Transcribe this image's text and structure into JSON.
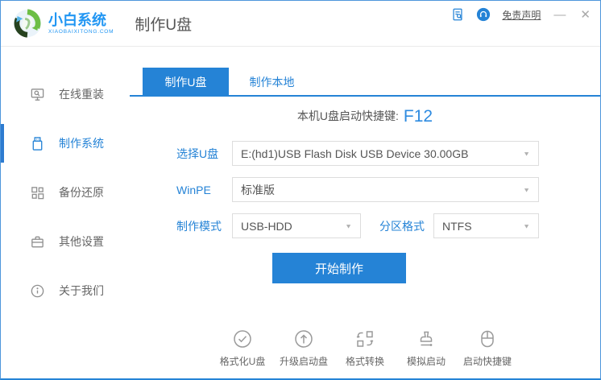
{
  "colors": {
    "primary": "#2583D6",
    "logo_blue": "#2196F3",
    "active_tab_bg": "#2583D6",
    "window_border": "#4E96DB",
    "text_gray": "#555555",
    "sidebar_text": "#666666"
  },
  "icons": {
    "dropdown_arrow": "▼",
    "titlebar": [
      "feedback-doc-icon",
      "support-headset-icon"
    ],
    "logo": "sync-circle-logo"
  },
  "titlebar": {
    "disclaimer_label": "免责声明",
    "minimize_glyph": "—",
    "close_glyph": "✕"
  },
  "header": {
    "logo_title": "小白系统",
    "logo_subtitle": "XIAOBAIXITONG.COM",
    "page_title": "制作U盘"
  },
  "sidebar": {
    "items": [
      {
        "label": "在线重装",
        "icon": "monitor-reinstall-icon",
        "active": false
      },
      {
        "label": "制作系统",
        "icon": "usb-drive-icon",
        "active": true
      },
      {
        "label": "备份还原",
        "icon": "backup-grid-icon",
        "active": false
      },
      {
        "label": "其他设置",
        "icon": "toolbox-icon",
        "active": false
      },
      {
        "label": "关于我们",
        "icon": "info-circle-icon",
        "active": false
      }
    ]
  },
  "tabs": [
    {
      "label": "制作U盘",
      "active": true
    },
    {
      "label": "制作本地",
      "active": false
    }
  ],
  "main": {
    "hotkey_label": "本机U盘启动快捷键:",
    "hotkey_value": "F12",
    "form": {
      "usb_drive": {
        "label": "选择U盘",
        "value": "E:(hd1)USB Flash Disk USB Device 30.00GB"
      },
      "winpe": {
        "label": "WinPE",
        "value": "标准版"
      },
      "make_mode": {
        "label": "制作模式",
        "value": "USB-HDD"
      },
      "partition": {
        "label": "分区格式",
        "value": "NTFS"
      }
    },
    "start_button_label": "开始制作",
    "utilities": [
      {
        "label": "格式化U盘",
        "icon": "check-circle-icon"
      },
      {
        "label": "升级启动盘",
        "icon": "arrow-up-circle-icon"
      },
      {
        "label": "格式转换",
        "icon": "convert-icon"
      },
      {
        "label": "模拟启动",
        "icon": "stamp-icon"
      },
      {
        "label": "启动快捷键",
        "icon": "mouse-icon"
      }
    ]
  }
}
